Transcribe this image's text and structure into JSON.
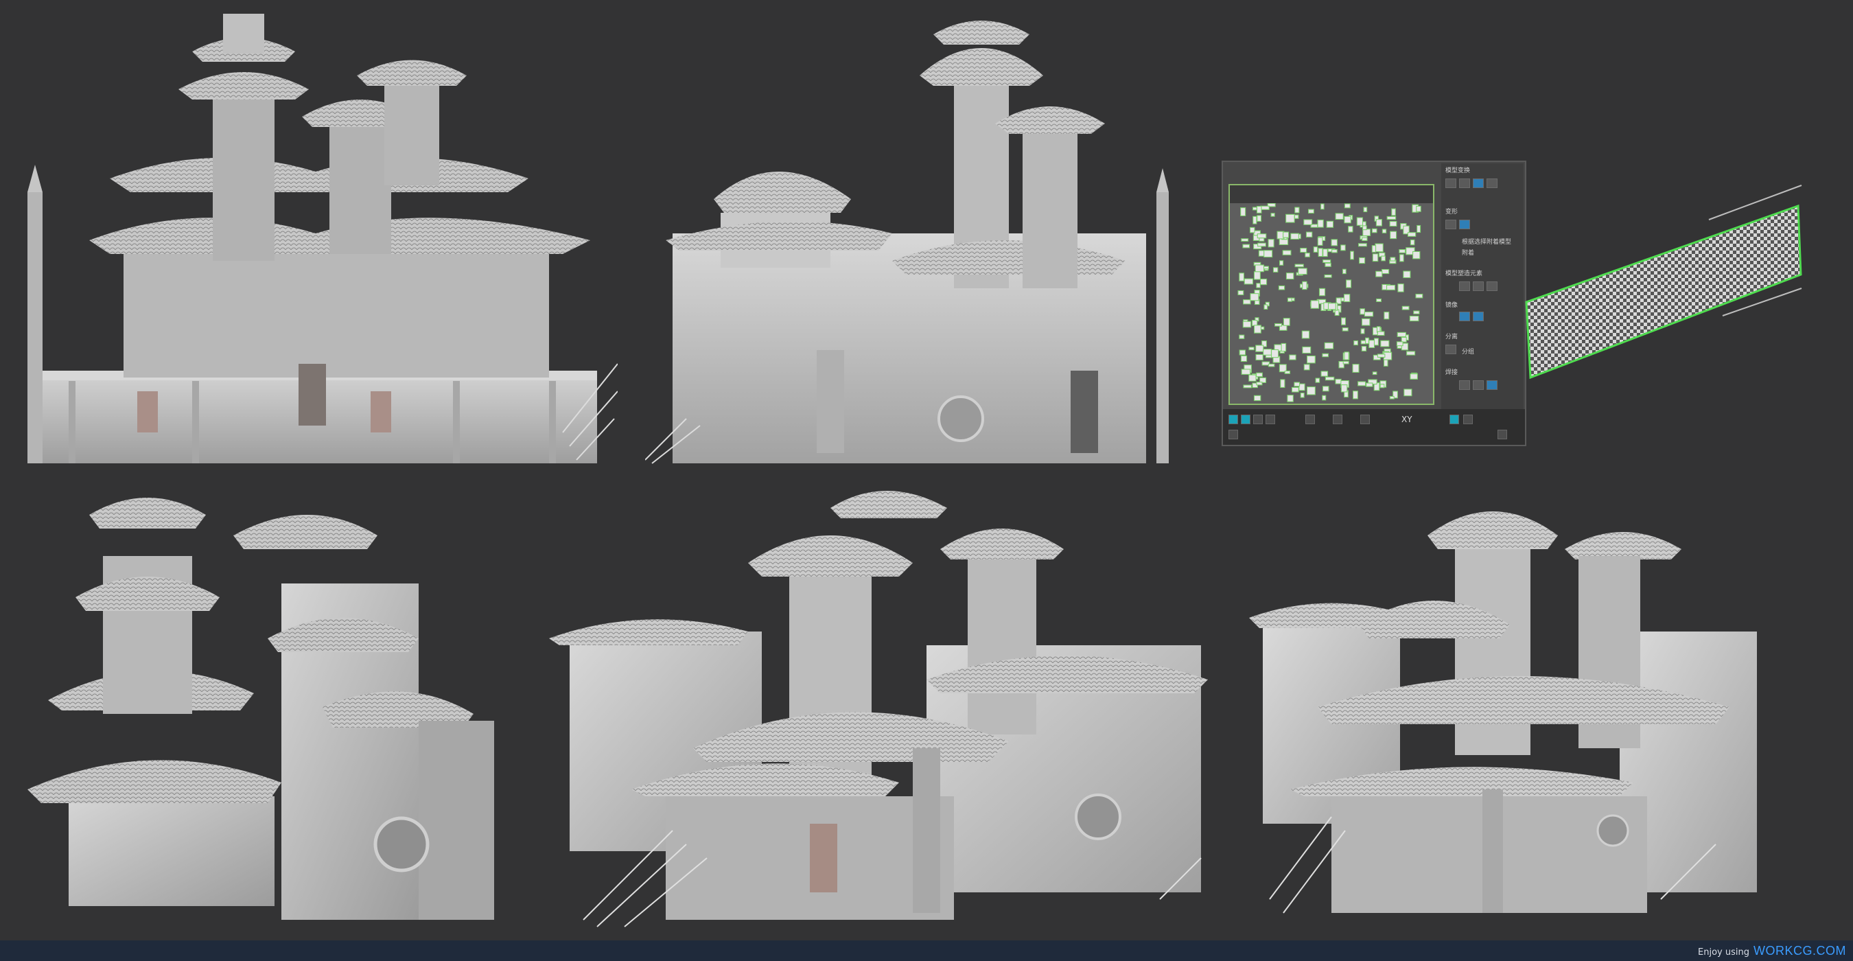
{
  "page": {
    "background": "#333334",
    "footer_background": "#1f2a3b"
  },
  "renders": [
    {
      "name": "palace-front-view",
      "shade": "#bdbdbd"
    },
    {
      "name": "palace-side-view",
      "shade": "#c2c2c2"
    },
    {
      "name": "tower-pair-perspective",
      "shade": "#bfbfbf"
    },
    {
      "name": "palace-perspective-center",
      "shade": "#c4c4c4"
    },
    {
      "name": "palace-perspective-right",
      "shade": "#c8c8c8"
    }
  ],
  "max_panel": {
    "sections": [
      "模型变换",
      "变形",
      "模型塑造元素",
      "镜像",
      "分离",
      "焊接"
    ],
    "sub_buttons": [
      "根据选择附着模型",
      "附着",
      "镜像",
      "分组"
    ],
    "axis_label": "XY",
    "selection_color": "#7bd16b"
  },
  "footer": {
    "prefix": "Enjoy using",
    "brand": "WORKCG.COM",
    "brand_color": "#3b9cff"
  }
}
